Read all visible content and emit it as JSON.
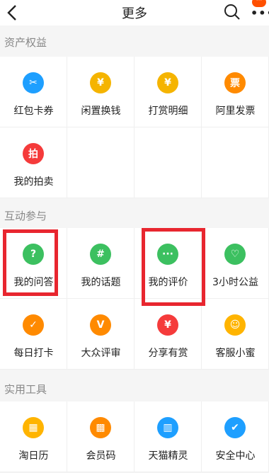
{
  "header": {
    "title": "更多",
    "badge": "···"
  },
  "sections": [
    {
      "title": "资产权益",
      "items": [
        {
          "label": "红包卡券",
          "icon": "ticket-icon",
          "color": "#1e9fff",
          "glyph": "✂"
        },
        {
          "label": "闲置换钱",
          "icon": "yen-coin-icon",
          "color": "#f5b400",
          "glyph": "¥"
        },
        {
          "label": "打赏明细",
          "icon": "yen-hand-icon",
          "color": "#f5b400",
          "glyph": "¥"
        },
        {
          "label": "阿里发票",
          "icon": "invoice-icon",
          "color": "#ff8a00",
          "glyph": "票"
        },
        {
          "label": "我的拍卖",
          "icon": "auction-icon",
          "color": "#f53b3b",
          "glyph": "拍"
        }
      ]
    },
    {
      "title": "互动参与",
      "items": [
        {
          "label": "我的问答",
          "icon": "question-bubble-icon",
          "color": "#3cc060",
          "glyph": "?"
        },
        {
          "label": "我的话题",
          "icon": "hashtag-icon",
          "color": "#3cc060",
          "glyph": "#"
        },
        {
          "label": "我的评价",
          "icon": "comment-bubble-icon",
          "color": "#3cc060",
          "glyph": "···"
        },
        {
          "label": "3小时公益",
          "icon": "heart-icon",
          "color": "#3cc060",
          "glyph": "♡"
        },
        {
          "label": "每日打卡",
          "icon": "calendar-check-icon",
          "color": "#ff8a00",
          "glyph": "✓"
        },
        {
          "label": "大众评审",
          "icon": "reviewer-icon",
          "color": "#ff8a00",
          "glyph": "V"
        },
        {
          "label": "分享有赏",
          "icon": "money-bag-icon",
          "color": "#f53b3b",
          "glyph": "¥"
        },
        {
          "label": "客服小蜜",
          "icon": "customer-service-icon",
          "color": "#ffb400",
          "glyph": "☺"
        }
      ]
    },
    {
      "title": "实用工具",
      "items": [
        {
          "label": "淘日历",
          "icon": "calendar-icon",
          "color": "#ffb400",
          "glyph": "▦"
        },
        {
          "label": "会员码",
          "icon": "qr-code-icon",
          "color": "#ff8a00",
          "glyph": "▩"
        },
        {
          "label": "天猫精灵",
          "icon": "smart-speaker-icon",
          "color": "#1e9fff",
          "glyph": "▥"
        },
        {
          "label": "安全中心",
          "icon": "shield-icon",
          "color": "#1e9fff",
          "glyph": "✔"
        }
      ]
    }
  ]
}
